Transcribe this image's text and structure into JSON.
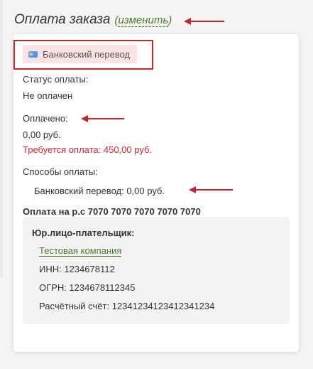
{
  "header": {
    "title": "Оплата заказа",
    "change_open": "(",
    "change_link": "изменить",
    "change_close": ")"
  },
  "payment_method": {
    "icon": "credit-card-icon",
    "label": "Банковский перевод"
  },
  "status": {
    "label": "Статус оплаты:",
    "value": "Не оплачен"
  },
  "paid": {
    "label": "Оплачено:",
    "value": "0,00 руб.",
    "required": "Требуется оплата: 450,00 руб."
  },
  "methods": {
    "label": "Способы оплаты:",
    "items": [
      "Банковский перевод: 0,00 руб."
    ]
  },
  "account": {
    "title": "Оплата на р.с 7070 7070 7070 7070 7070"
  },
  "payer": {
    "heading": "Юр.лицо-плательщик:",
    "company": "Тестовая компания",
    "inn": "ИНН: 1234678112",
    "ogrn": "ОГРН: 1234678112345",
    "account": "Расчётный счёт: 12341234123412341234"
  },
  "colors": {
    "annotation_red": "#c0282d",
    "link_green": "#4a7a2a",
    "warning_red": "#d7262f",
    "badge_bg": "#fbe3e4"
  }
}
